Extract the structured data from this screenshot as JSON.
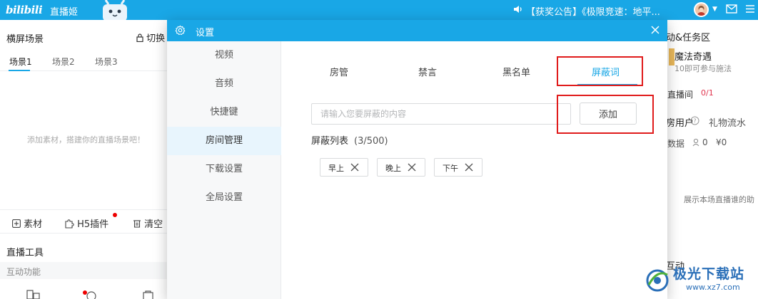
{
  "topbar": {
    "logo_text": "bilibili",
    "app_name": "直播姬",
    "announcement": "【获奖公告】《极限竞速：地平...",
    "bg_color": "#19a7e6"
  },
  "left_panel": {
    "scene_header": "横屏场景",
    "switch_label": "切换",
    "scene_tabs": [
      {
        "label": "场景1",
        "active": true
      },
      {
        "label": "场景2",
        "active": false
      },
      {
        "label": "场景3",
        "active": false
      }
    ],
    "empty_hint": "添加素材，搭建你的直播场景吧！",
    "toolbar": {
      "material_label": "素材",
      "h5_plugin_label": "H5插件",
      "clear_label": "清空"
    },
    "tools_header": "直播工具",
    "interaction_label": "互动功能"
  },
  "right_panel": {
    "section_title": "动&任务区",
    "event_title": "魔法奇遇",
    "event_sub": "10即可参与施法",
    "live_label": "直播间",
    "live_count": "0/1",
    "users_label": "房用户",
    "gift_flow_label": "礼物流水",
    "data_label": "数据",
    "data_people": "0",
    "data_money": "¥0",
    "bottom_hint": "展示本场直播谁的助",
    "interact_label": "互动"
  },
  "dialog": {
    "title": "设置",
    "nav_items": [
      {
        "label": "视频",
        "active": false
      },
      {
        "label": "音频",
        "active": false
      },
      {
        "label": "快捷键",
        "active": false
      },
      {
        "label": "房间管理",
        "active": true
      },
      {
        "label": "下载设置",
        "active": false
      },
      {
        "label": "全局设置",
        "active": false
      }
    ],
    "sub_tabs": [
      {
        "label": "房管",
        "active": false
      },
      {
        "label": "禁言",
        "active": false
      },
      {
        "label": "黑名单",
        "active": false
      },
      {
        "label": "屏蔽词",
        "active": true
      }
    ],
    "input_placeholder": "请输入您要屏蔽的内容",
    "input_value": "",
    "add_button": "添加",
    "list_label": "屏蔽列表",
    "list_count": "(3/500)",
    "words": [
      "早上",
      "晚上",
      "下午"
    ]
  },
  "watermark": {
    "text": "极光下载站",
    "url": "www.xz7.com"
  },
  "colors": {
    "accent": "#19a7e6",
    "highlight": "#e01b1b",
    "badge_red": "#e00000"
  }
}
